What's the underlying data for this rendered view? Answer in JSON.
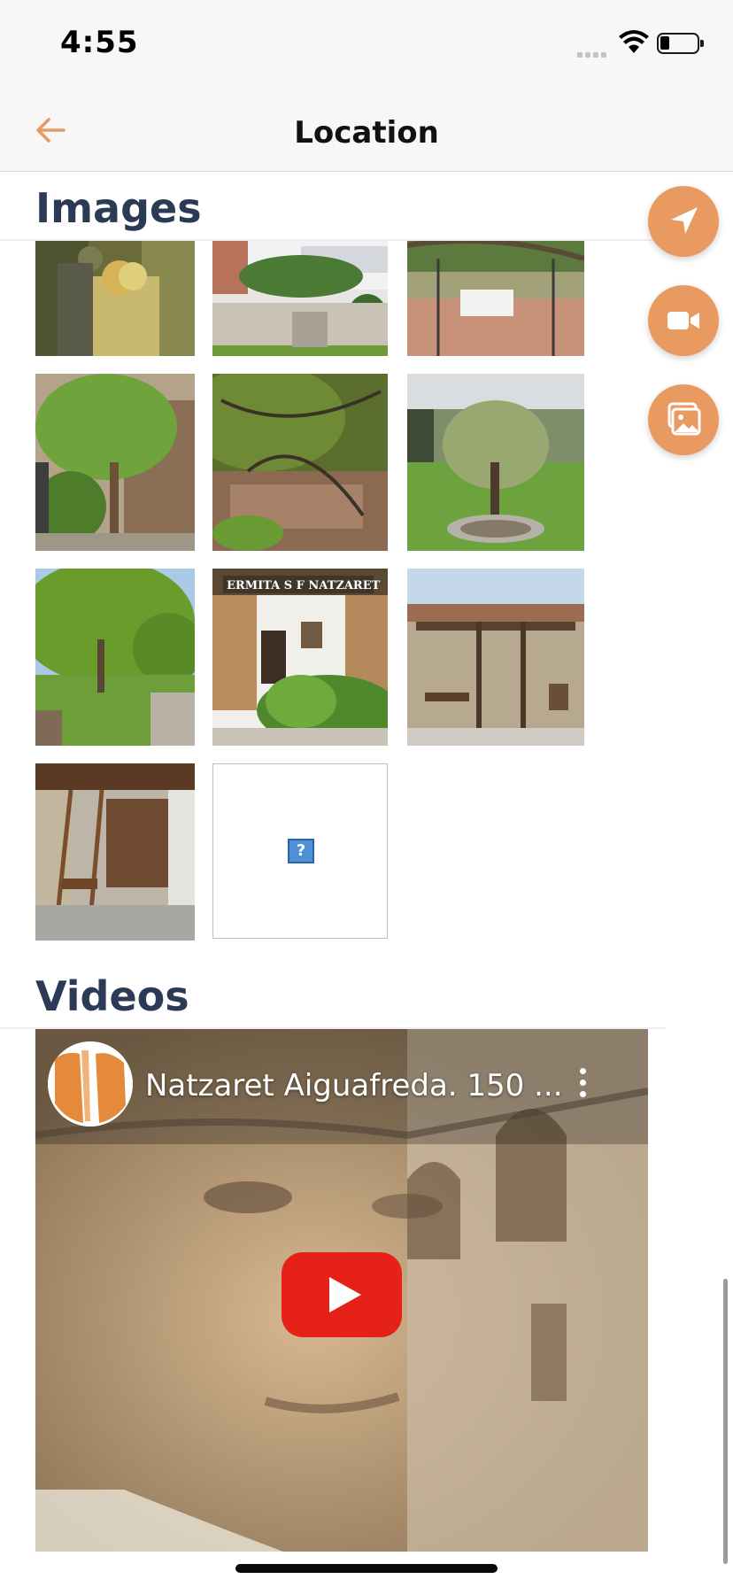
{
  "status_bar": {
    "time": "4:55"
  },
  "nav": {
    "title": "Location",
    "back_icon": "arrow-left-icon"
  },
  "images_section": {
    "title": "Images",
    "thumbnails": [
      "saint-and-child-painting",
      "building-garden-stairs",
      "terrace-table-pergola",
      "tree-and-stone-wall",
      "tree-branches-wall",
      "olive-tree-garden",
      "garden-trees-path",
      "ermita-sign-plants",
      "stone-porch-tools",
      "wooden-porch-ladder",
      "broken-image"
    ],
    "broken_image_glyph": "?"
  },
  "videos_section": {
    "title": "Videos",
    "video": {
      "title": "Natzaret Aiguafreda. 150 ..."
    }
  },
  "fabs": [
    "navigate-arrow-icon",
    "video-camera-icon",
    "photo-gallery-icon"
  ],
  "colors": {
    "accent": "#e99a61",
    "section_title": "#2c3b55",
    "youtube_red": "#e62117"
  }
}
